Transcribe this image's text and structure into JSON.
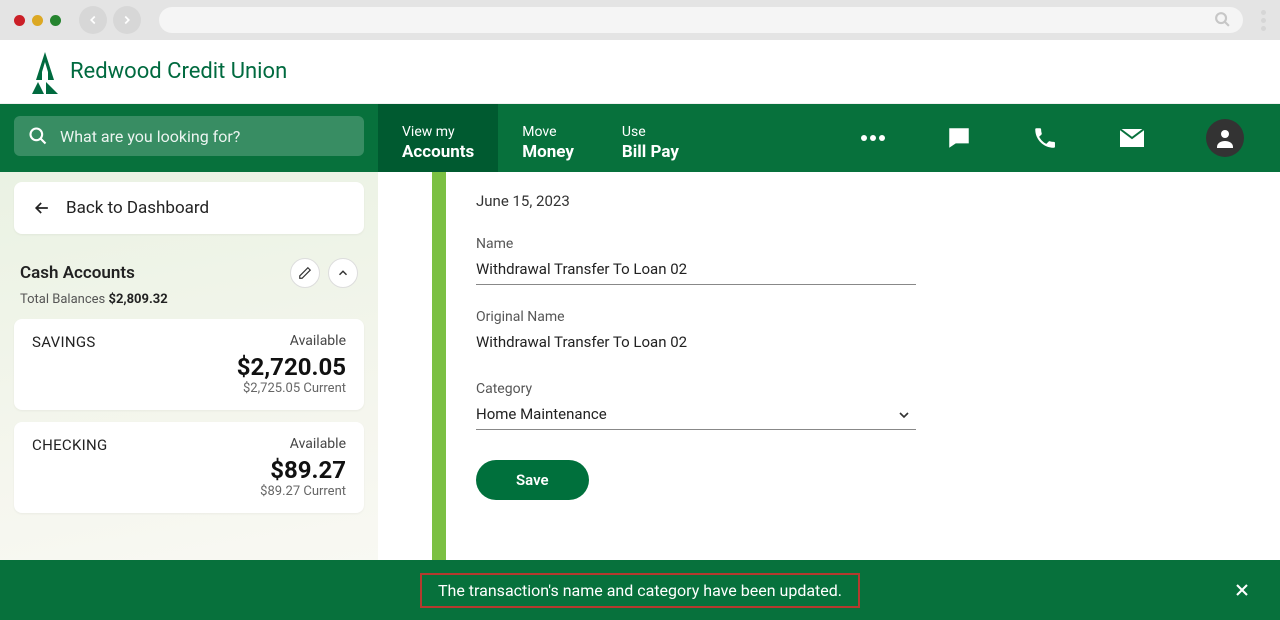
{
  "logo": {
    "text": "Redwood Credit Union"
  },
  "search": {
    "placeholder": "What are you looking for?"
  },
  "nav": {
    "tabs": [
      {
        "line1": "View my",
        "line2": "Accounts"
      },
      {
        "line1": "Move",
        "line2": "Money"
      },
      {
        "line1": "Use",
        "line2": "Bill Pay"
      }
    ]
  },
  "sidebar": {
    "back_label": "Back to Dashboard",
    "section_title": "Cash Accounts",
    "total_label": "Total Balances",
    "total_value": "$2,809.32",
    "accounts": [
      {
        "name": "SAVINGS",
        "avail_label": "Available",
        "amount": "$2,720.05",
        "current": "$2,725.05 Current"
      },
      {
        "name": "CHECKING",
        "avail_label": "Available",
        "amount": "$89.27",
        "current": "$89.27 Current"
      }
    ]
  },
  "form": {
    "date": "June 15, 2023",
    "name_label": "Name",
    "name_value": "Withdrawal Transfer To Loan 02",
    "orig_label": "Original Name",
    "orig_value": "Withdrawal Transfer To Loan 02",
    "cat_label": "Category",
    "cat_value": "Home Maintenance",
    "save_label": "Save"
  },
  "toast": {
    "message": "The transaction's name and category have been updated."
  }
}
